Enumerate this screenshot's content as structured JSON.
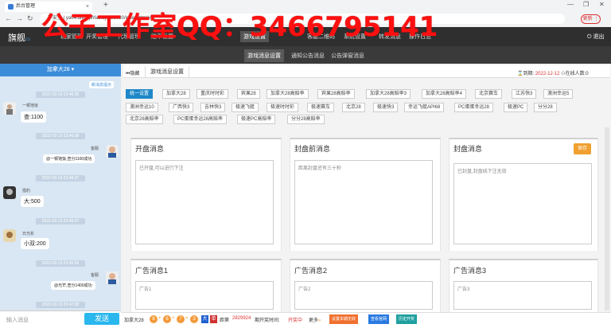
{
  "browser": {
    "tab_title": "后台管理",
    "url": "不安全 | ya04.dfl07.jihfae.cyou:8080/index.html#/...",
    "update_label": "更新 ⋮",
    "watermark": "公子工作室QQ：3466795141"
  },
  "topnav": {
    "logo": "旗舰",
    "logo_suffix": "cs",
    "items": [
      "游戏设置",
      "玩家管理",
      "开奖管理",
      "代理管理",
      "赔率设置",
      "游戏设置",
      "客服二维码",
      "系统设置",
      "转发消息",
      "操作日志"
    ],
    "exit": "退出"
  },
  "subnav": [
    "游戏消息设置",
    "通知公告消息",
    "公告弹窗消息"
  ],
  "chat": {
    "header": "加拿大28 ▾",
    "welcome": "新消息提示",
    "messages": [
      {
        "time": "2022-03-13 23:46:35",
        "user": "一顿饱饭",
        "text": "查:1100",
        "side": "left"
      },
      {
        "time": "2022-03-13 23:46:38",
        "user": "客服",
        "text": "@一顿饱饭,查分1100成功",
        "side": "right"
      },
      {
        "time": "2022-03-13 23:46:37",
        "user": "猎豹",
        "text": "大:500",
        "side": "left"
      },
      {
        "time": "2022-03-13 23:46:37",
        "user": "日光析",
        "text": "小双:200",
        "side": "left"
      },
      {
        "time": "2022-03-13 23:46:55",
        "user": "客服",
        "text": "@光芒,查分1400成功",
        "side": "right"
      },
      {
        "time": "2022-03-13 23:47:08",
        "user": "",
        "text": "",
        "side": "left"
      }
    ],
    "input_placeholder": "输入消息",
    "send": "发送"
  },
  "main": {
    "crumb_icon": "隐藏",
    "crumb_tab": "游戏消息设置",
    "expire_label": "到期:",
    "expire_date": "2022-12-12",
    "online": "在线人数:0",
    "tags": [
      "统一设置",
      "加拿大28",
      "重庆时时彩",
      "宾果28",
      "加拿大28高赔率",
      "宾果28高赔率",
      "加拿大28高赔率3",
      "加拿大28高赔率4",
      "北京赛车",
      "江苏快3",
      "澳洲幸运5",
      "澳洲幸运10",
      "广西快3",
      "吉林快3",
      "极速飞艇",
      "极速时时彩",
      "极速赛车",
      "北京28",
      "极速快3",
      "幸运飞艇API68",
      "PC蛋蛋幸运28",
      "极速PC",
      "分分28",
      "北京28高赔率",
      "PC蛋蛋幸运28高赔率",
      "极速PC高赔率",
      "分分28高赔率"
    ],
    "panels": [
      {
        "title": "开盘消息",
        "content": "已开盘,可以进行下注"
      },
      {
        "title": "封盘前消息",
        "content": "距离封盘还有三十秒"
      },
      {
        "title": "封盘消息",
        "content": "已封盘,封盘线下注无效"
      },
      {
        "title": "广告消息1",
        "content": "广告1"
      },
      {
        "title": "广告消息2",
        "content": "广告2"
      },
      {
        "title": "广告消息3",
        "content": "广告3"
      }
    ],
    "save": "保存"
  },
  "status": {
    "game": "加拿大28",
    "balls": [
      "8",
      "6",
      "7",
      "3"
    ],
    "size": "大",
    "parity": "单",
    "period_prefix": "距第",
    "period": "2829924",
    "period_suffix": "期开奖时间:",
    "state": "开奖中",
    "more": "更多",
    "btn1": "设置本期无效",
    "btn2": "查看官网",
    "btn3": "历史开奖"
  }
}
